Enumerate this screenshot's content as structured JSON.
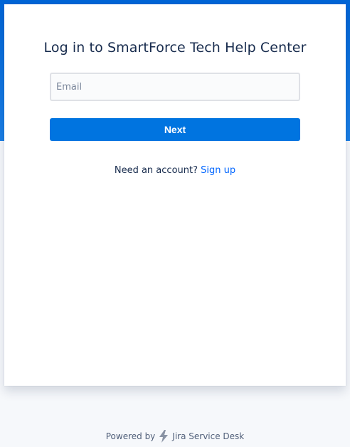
{
  "login": {
    "title": "Log in to SmartForce Tech Help Center",
    "email_placeholder": "Email",
    "email_value": "",
    "next_label": "Next",
    "signup_prompt": "Need an account?",
    "signup_link": "Sign up"
  },
  "footer": {
    "powered_by": "Powered by",
    "product_name": "Jira Service Desk",
    "product_icon": "bolt-icon"
  },
  "colors": {
    "header_band": "#0065d6",
    "primary_button": "#0074e0",
    "link": "#0065ff",
    "title_text": "#172b4d"
  }
}
